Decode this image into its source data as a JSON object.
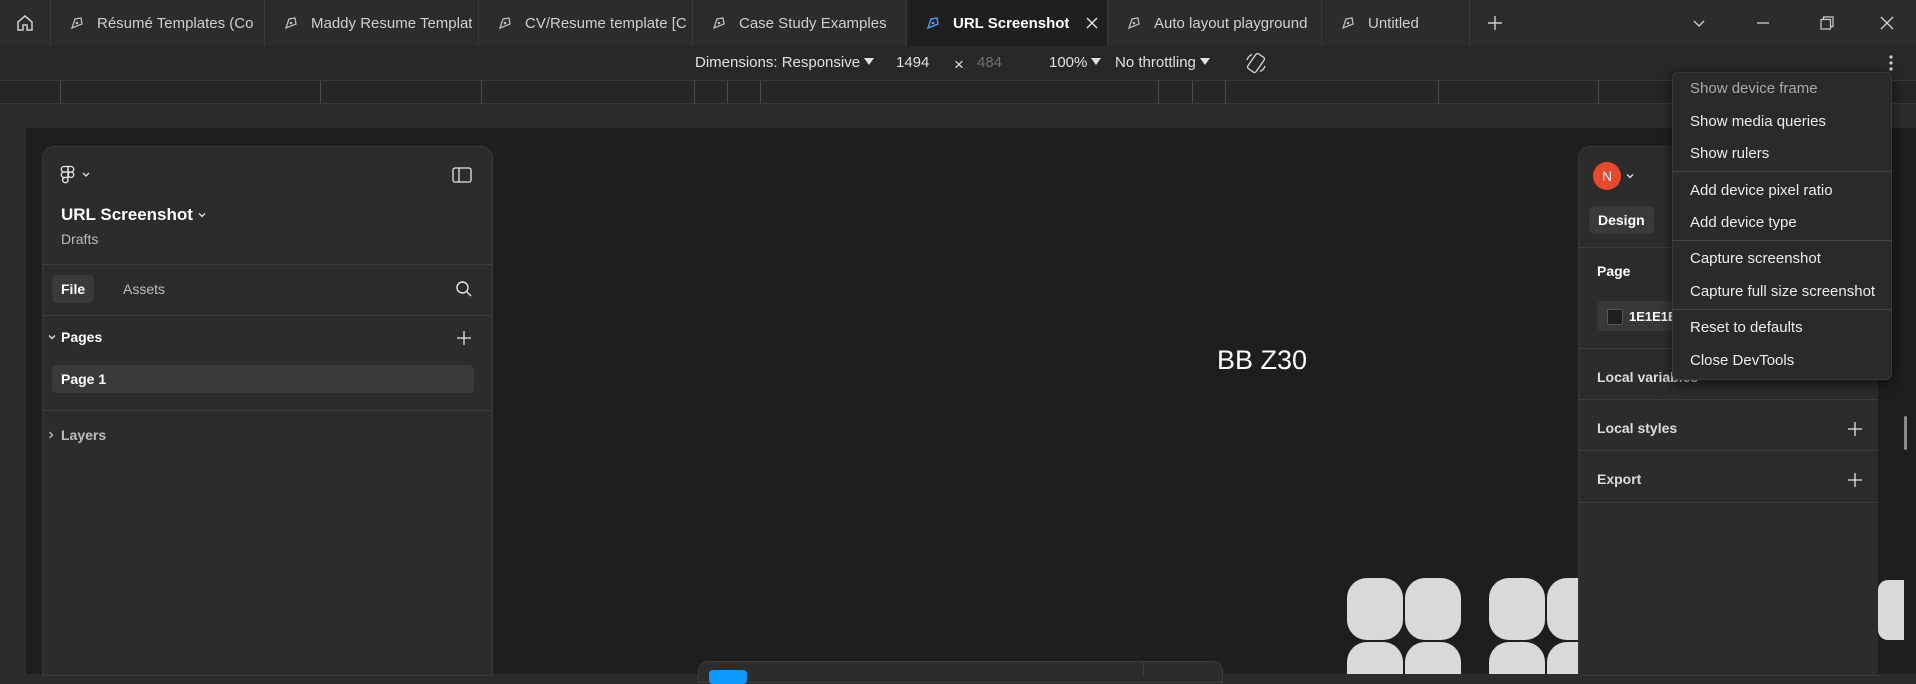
{
  "tabs": [
    {
      "label": "Résumé Templates (Co"
    },
    {
      "label": "Maddy Resume Templat"
    },
    {
      "label": "CV/Resume template [C"
    },
    {
      "label": "Case Study Examples"
    },
    {
      "label": "URL Screenshot",
      "active": true
    },
    {
      "label": "Auto layout playground"
    },
    {
      "label": "Untitled"
    }
  ],
  "devtools": {
    "dimensions_label": "Dimensions: Responsive",
    "width": "1494",
    "separator": "×",
    "height_placeholder": "484",
    "zoom": "100%",
    "throttling": "No throttling"
  },
  "left_panel": {
    "file_title": "URL Screenshot",
    "location": "Drafts",
    "tabs": [
      "File",
      "Assets"
    ],
    "pages_header": "Pages",
    "pages": [
      "Page 1"
    ],
    "layers_header": "Layers"
  },
  "canvas": {
    "text": "BB Z30"
  },
  "right_panel": {
    "avatar_initial": "N",
    "avatar_color": "#e8492c",
    "design_tab": "Design",
    "page_header": "Page",
    "bg_color_value": "1E1E1E",
    "sections": [
      "Local variables",
      "Local styles",
      "Export"
    ]
  },
  "context_menu": {
    "items": [
      {
        "label": "Show device frame",
        "disabled": true
      },
      {
        "label": "Show media queries"
      },
      {
        "label": "Show rulers"
      },
      {
        "label": "Add device pixel ratio"
      },
      {
        "label": "Add device type"
      },
      {
        "label": "Capture screenshot"
      },
      {
        "label": "Capture full size screenshot"
      },
      {
        "label": "Reset to defaults"
      },
      {
        "label": "Close DevTools"
      }
    ]
  },
  "colors": {
    "active_tab_icon": "#4a9ff5",
    "chrome_bg": "#2c2c2c",
    "canvas_bg": "#1e1e1e"
  }
}
